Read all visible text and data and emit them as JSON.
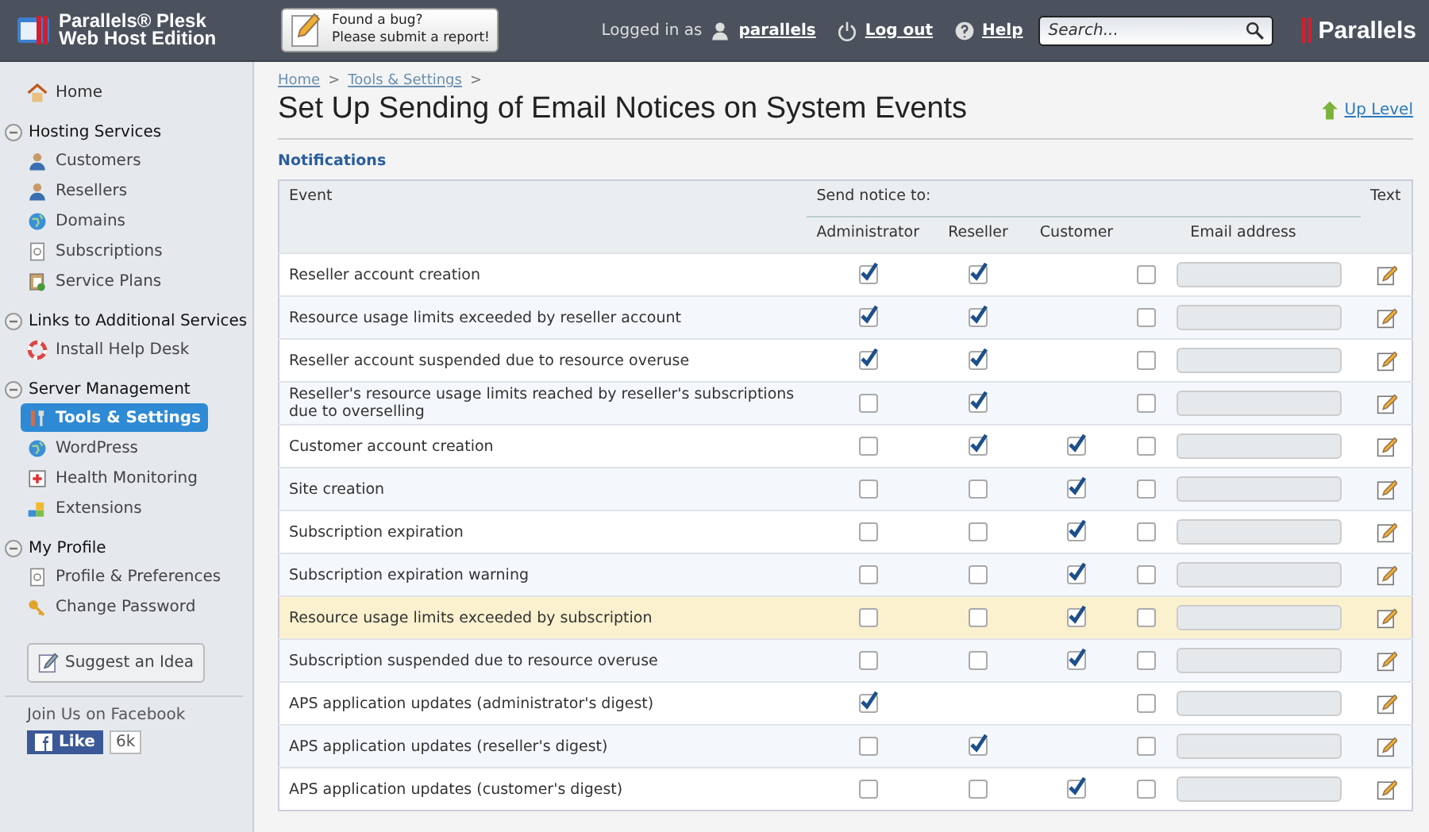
{
  "header": {
    "product_line1": "Parallels® Plesk",
    "product_line2": "Web Host Edition",
    "bug_report_line1": "Found a bug?",
    "bug_report_line2": "Please submit a report!",
    "logged_in_label": "Logged in as",
    "username": "parallels",
    "logout": "Log out",
    "help": "Help",
    "search": {
      "placeholder": "Search..."
    },
    "brand": "Parallels"
  },
  "sidebar": {
    "home": "Home",
    "sections": [
      {
        "title": "Hosting Services",
        "expanded": true,
        "items": [
          {
            "label": "Customers",
            "selected": false
          },
          {
            "label": "Resellers",
            "selected": false
          },
          {
            "label": "Domains",
            "selected": false
          },
          {
            "label": "Subscriptions",
            "selected": false
          },
          {
            "label": "Service Plans",
            "selected": false
          }
        ]
      },
      {
        "title": "Links to Additional Services",
        "expanded": true,
        "items": [
          {
            "label": "Install Help Desk",
            "selected": false
          }
        ]
      },
      {
        "title": "Server Management",
        "expanded": true,
        "items": [
          {
            "label": "Tools & Settings",
            "selected": true
          },
          {
            "label": "WordPress",
            "selected": false
          },
          {
            "label": "Health Monitoring",
            "selected": false
          },
          {
            "label": "Extensions",
            "selected": false
          }
        ]
      },
      {
        "title": "My Profile",
        "expanded": true,
        "items": [
          {
            "label": "Profile & Preferences",
            "selected": false
          },
          {
            "label": "Change Password",
            "selected": false
          }
        ]
      }
    ],
    "suggest": "Suggest an Idea",
    "facebook_title": "Join Us on Facebook",
    "like": "Like",
    "like_count": "6k"
  },
  "breadcrumbs": [
    {
      "label": "Home",
      "separator": ">"
    },
    {
      "label": "Tools & Settings",
      "separator": ">"
    }
  ],
  "title": "Set Up Sending of Email Notices on System Events",
  "up_level": "Up Level",
  "section_title": "Notifications",
  "table": {
    "columns": {
      "event": "Event",
      "send_notice_to": "Send notice to:",
      "administrator": "Administrator",
      "reseller": "Reseller",
      "customer": "Customer",
      "email": "Email address",
      "text": "Text"
    },
    "rows": [
      {
        "event": "Reseller account creation",
        "administrator": true,
        "reseller": true,
        "other": false,
        "highlighted": false
      },
      {
        "event": "Resource usage limits exceeded by reseller account",
        "administrator": true,
        "reseller": true,
        "other": false,
        "highlighted": false
      },
      {
        "event": "Reseller account suspended due to resource overuse",
        "administrator": true,
        "reseller": true,
        "other": false,
        "highlighted": false
      },
      {
        "event": "Reseller's resource usage limits reached by reseller's subscriptions due to overselling",
        "administrator": false,
        "reseller": true,
        "other": false,
        "highlighted": false
      },
      {
        "event": "Customer account creation",
        "administrator": false,
        "reseller": true,
        "customer": true,
        "other": false,
        "highlighted": false
      },
      {
        "event": "Site creation",
        "administrator": false,
        "reseller": false,
        "customer": true,
        "other": false,
        "highlighted": false
      },
      {
        "event": "Subscription expiration",
        "administrator": false,
        "reseller": false,
        "customer": true,
        "other": false,
        "highlighted": false
      },
      {
        "event": "Subscription expiration warning",
        "administrator": false,
        "reseller": false,
        "customer": true,
        "other": false,
        "highlighted": false
      },
      {
        "event": "Resource usage limits exceeded by subscription",
        "administrator": false,
        "reseller": false,
        "customer": true,
        "other": false,
        "highlighted": true
      },
      {
        "event": "Subscription suspended due to resource overuse",
        "administrator": false,
        "reseller": false,
        "customer": true,
        "other": false,
        "highlighted": false
      },
      {
        "event": "APS application updates (administrator's digest)",
        "administrator": true,
        "other": false,
        "highlighted": false
      },
      {
        "event": "APS application updates (reseller's digest)",
        "administrator": false,
        "reseller": true,
        "other": false,
        "highlighted": false
      },
      {
        "event": "APS application updates (customer's digest)",
        "administrator": false,
        "reseller": false,
        "customer": true,
        "other": false,
        "highlighted": false
      }
    ]
  }
}
